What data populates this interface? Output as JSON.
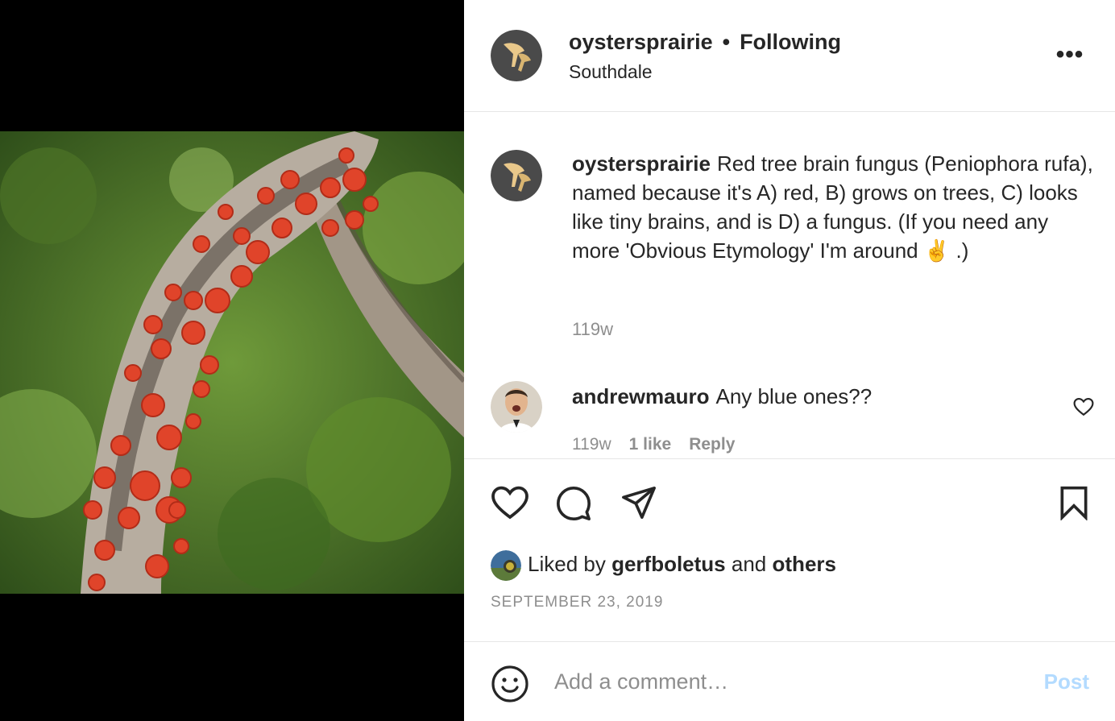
{
  "post": {
    "author": "oystersprairie",
    "separator": "•",
    "follow_status": "Following",
    "location": "Southdale",
    "more_icon": "more-dots-icon",
    "more_glyph": "•••"
  },
  "caption": {
    "author": "oystersprairie",
    "text_before_emoji": "Red tree brain fungus (Peniophora rufa), named because it's A) red, B) grows on trees, C) looks like tiny brains, and is D) a fungus. (If you need any more 'Obvious Etymology' I'm around",
    "emoji": "✌️",
    "text_after_emoji": ".)",
    "time": "119w"
  },
  "comment": {
    "author": "andrewmauro",
    "text": "Any blue ones??",
    "time": "119w",
    "likes": "1 like",
    "reply_label": "Reply"
  },
  "actions": {
    "like_icon": "heart-icon",
    "comment_icon": "comment-bubble-icon",
    "share_icon": "paper-plane-icon",
    "save_icon": "bookmark-icon"
  },
  "likes": {
    "prefix": "Liked by",
    "user": "gerfboletus",
    "connector": "and",
    "suffix": "others"
  },
  "date": "SEPTEMBER 23, 2019",
  "add_comment": {
    "emoji_icon": "smiley-icon",
    "placeholder": "Add a comment…",
    "post_label": "Post"
  },
  "colors": {
    "text": "#262626",
    "muted": "#8e8e8e",
    "post_button_disabled": "#b3dbff",
    "fungus_red": "#e0442a"
  }
}
